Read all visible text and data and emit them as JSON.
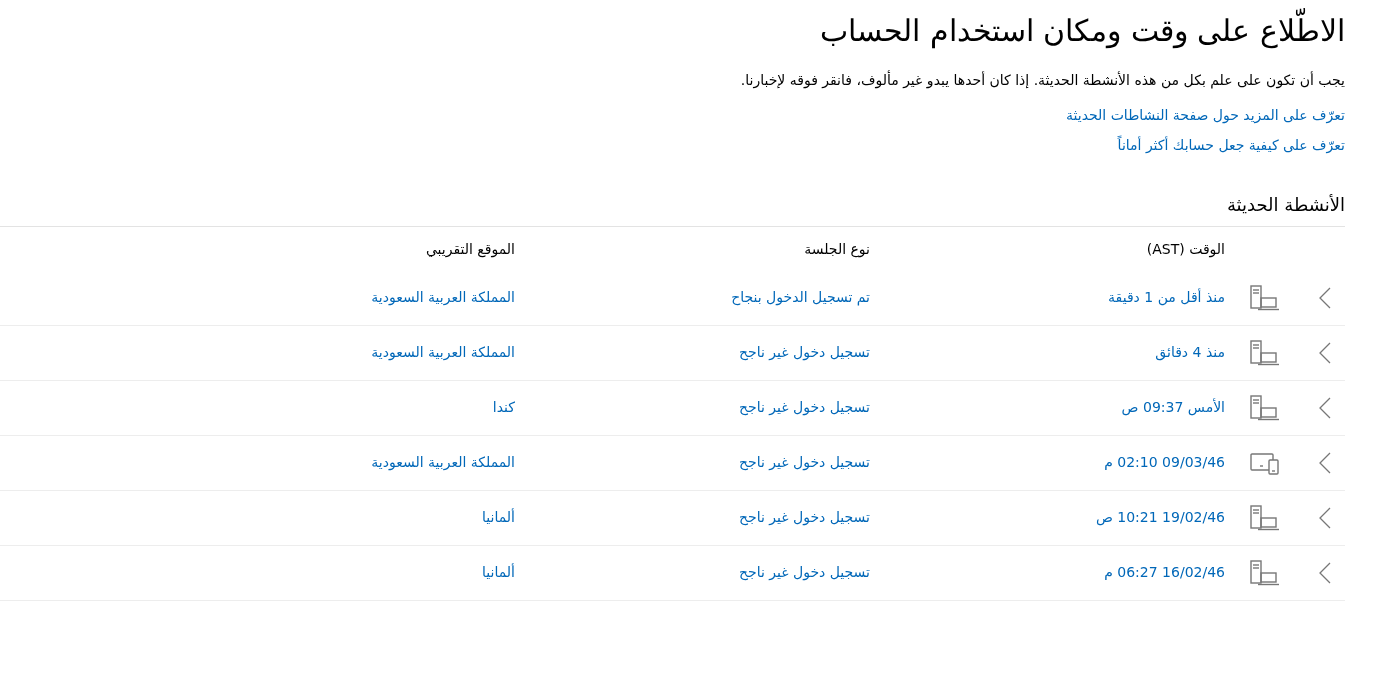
{
  "title": "الاطّلاع على وقت ومكان استخدام الحساب",
  "intro": "يجب أن تكون على علم بكل من هذه الأنشطة الحديثة. إذا كان أحدها يبدو غير مألوف، فانقر فوقه لإخبارنا.",
  "links": [
    "تعرّف على المزيد حول صفحة النشاطات الحديثة",
    "تعرّف على كيفية جعل حسابك أكثر أماناً"
  ],
  "section_title": "الأنشطة الحديثة",
  "table": {
    "columns": [
      "الوقت (AST)",
      "نوع الجلسة",
      "الموقع التقريبي"
    ],
    "rows": [
      {
        "kind": "desktop",
        "time": "منذ أقل من 1 دقيقة",
        "session": "تم تسجيل الدخول بنجاح",
        "location": "المملكة العربية السعودية"
      },
      {
        "kind": "desktop",
        "time": "منذ 4 دقائق",
        "session": "تسجيل دخول غير ناجح",
        "location": "المملكة العربية السعودية"
      },
      {
        "kind": "desktop",
        "time": "الأمس 09:37 ص",
        "session": "تسجيل دخول غير ناجح",
        "location": "كندا"
      },
      {
        "kind": "tablet",
        "time": "09/03/46 02:10 م",
        "session": "تسجيل دخول غير ناجح",
        "location": "المملكة العربية السعودية"
      },
      {
        "kind": "desktop",
        "time": "19/02/46 10:21 ص",
        "session": "تسجيل دخول غير ناجح",
        "location": "ألمانيا"
      },
      {
        "kind": "desktop",
        "time": "16/02/46 06:27 م",
        "session": "تسجيل دخول غير ناجح",
        "location": "ألمانيا"
      }
    ]
  }
}
